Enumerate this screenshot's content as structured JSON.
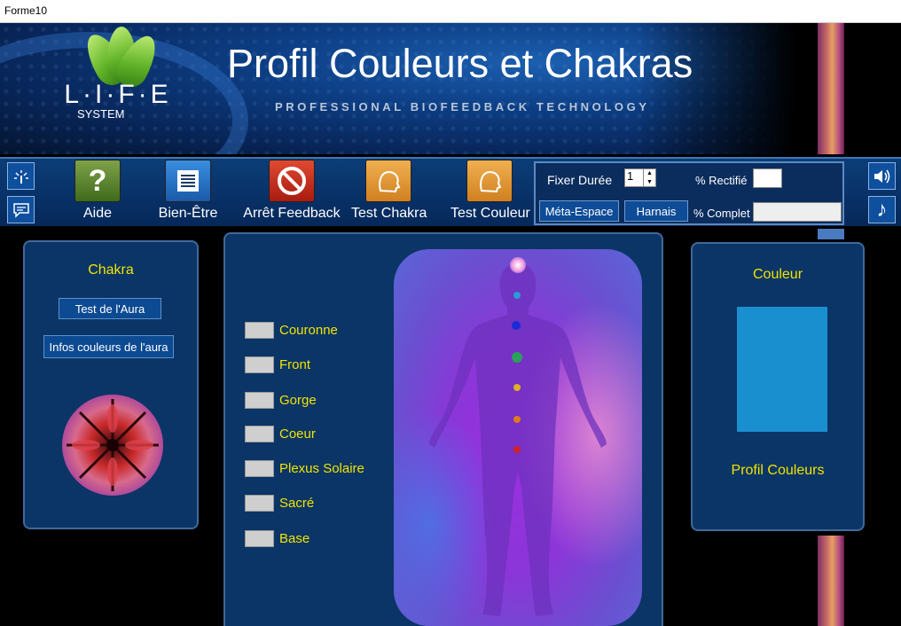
{
  "window": {
    "title": "Forme10"
  },
  "header": {
    "logo_text": "L·I·F·E",
    "logo_sub": "SYSTEM",
    "title": "Profil Couleurs et Chakras",
    "subtitle": "PROFESSIONAL BIOFEEDBACK TECHNOLOGY"
  },
  "toolbar": {
    "left_icons": [
      "signal-icon",
      "chat-icon"
    ],
    "buttons": [
      {
        "label": "Aide",
        "icon": "question-icon",
        "color": "#4f7d2a"
      },
      {
        "label": "Bien-Être",
        "icon": "list-icon",
        "color": "#1e6dc8"
      },
      {
        "label": "Arrêt Feedback",
        "icon": "stop-icon",
        "color": "#c0281a"
      },
      {
        "label": "Test Chakra",
        "icon": "head-icon",
        "color": "#e39a2a"
      },
      {
        "label": "Test Couleur",
        "icon": "head-icon",
        "color": "#e39a2a"
      }
    ],
    "right_icons": [
      "speaker-icon",
      "music-note-icon"
    ]
  },
  "settings": {
    "fixer_duree_label": "Fixer Durée",
    "fixer_duree_value": "1",
    "rectifie_label": "% Rectifié",
    "complet_label": "% Complet",
    "meta_espace_label": "Méta-Espace",
    "harnais_label": "Harnais"
  },
  "left_panel": {
    "title": "Chakra",
    "test_aura_label": "Test de l'Aura",
    "infos_label": "Infos couleurs de l'aura"
  },
  "chakras": [
    {
      "name": "Couronne",
      "color": "#e0a0e0"
    },
    {
      "name": "Front",
      "color": "#2a9ad8"
    },
    {
      "name": "Gorge",
      "color": "#2a3ad0"
    },
    {
      "name": "Coeur",
      "color": "#2aa05a"
    },
    {
      "name": "Plexus Solaire",
      "color": "#e0b020"
    },
    {
      "name": "Sacré",
      "color": "#e07a20"
    },
    {
      "name": "Base",
      "color": "#d0202a"
    }
  ],
  "right_panel": {
    "title": "Couleur",
    "swatch_color": "#1a8fd0",
    "footer": "Profil Couleurs"
  },
  "colors": {
    "accent_yellow": "#f1e400",
    "panel_bg": "#0a3566"
  }
}
